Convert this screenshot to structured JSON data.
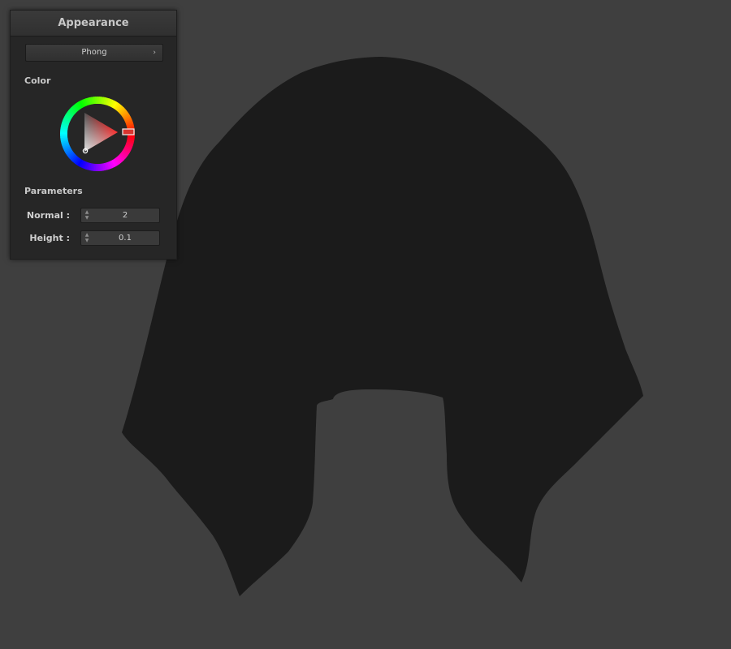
{
  "panel": {
    "title": "Appearance",
    "shader": {
      "selected": "Phong",
      "icon": "chevron-right-icon"
    },
    "color_section": {
      "label": "Color",
      "selected_color": "#ff0000"
    },
    "parameters": {
      "label": "Parameters",
      "items": [
        {
          "label": "Normal :",
          "value": "2"
        },
        {
          "label": "Height :",
          "value": "0.1"
        }
      ]
    }
  },
  "viewport": {
    "background": "#3f3f3f",
    "mesh_color": "#1b1b1b"
  }
}
